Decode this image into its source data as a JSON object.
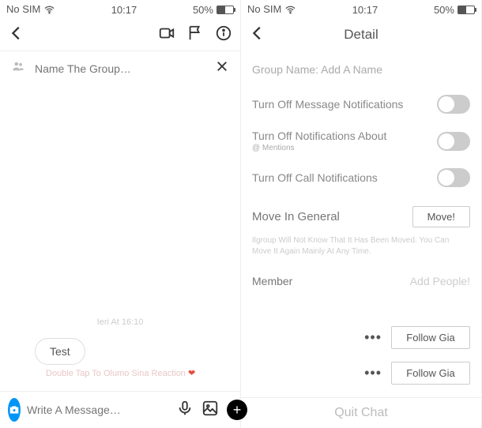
{
  "status": {
    "carrier": "No SIM",
    "time": "10:17",
    "battery_pct": "50%"
  },
  "left": {
    "name_placeholder": "Name The Group…",
    "timestamp": "Ieri At 16:10",
    "bubble_text": "Test",
    "reaction_note": "Double Tap To Olumo Sina Reaction",
    "heart": "❤",
    "composer_placeholder": "Write A Message…"
  },
  "right": {
    "header_title": "Detail",
    "group_name_label": "Group Name:",
    "group_name_value": "Add A Name",
    "settings": [
      {
        "label": "Turn Off Message Notifications",
        "sublabel": ""
      },
      {
        "label": "Turn Off Notifications About",
        "sublabel": "@ Mentions"
      },
      {
        "label": "Turn Off Call Notifications",
        "sublabel": ""
      }
    ],
    "move_label": "Move In General",
    "move_btn": "Move!",
    "move_note": "Ilgroup Will Not Know That It Has Been Moved. You Can Move It Again Mainly At Any Time.",
    "member_label": "Member",
    "add_people": "Add People!",
    "follow_btn": "Follow Gia",
    "quit_chat": "Quit Chat"
  }
}
